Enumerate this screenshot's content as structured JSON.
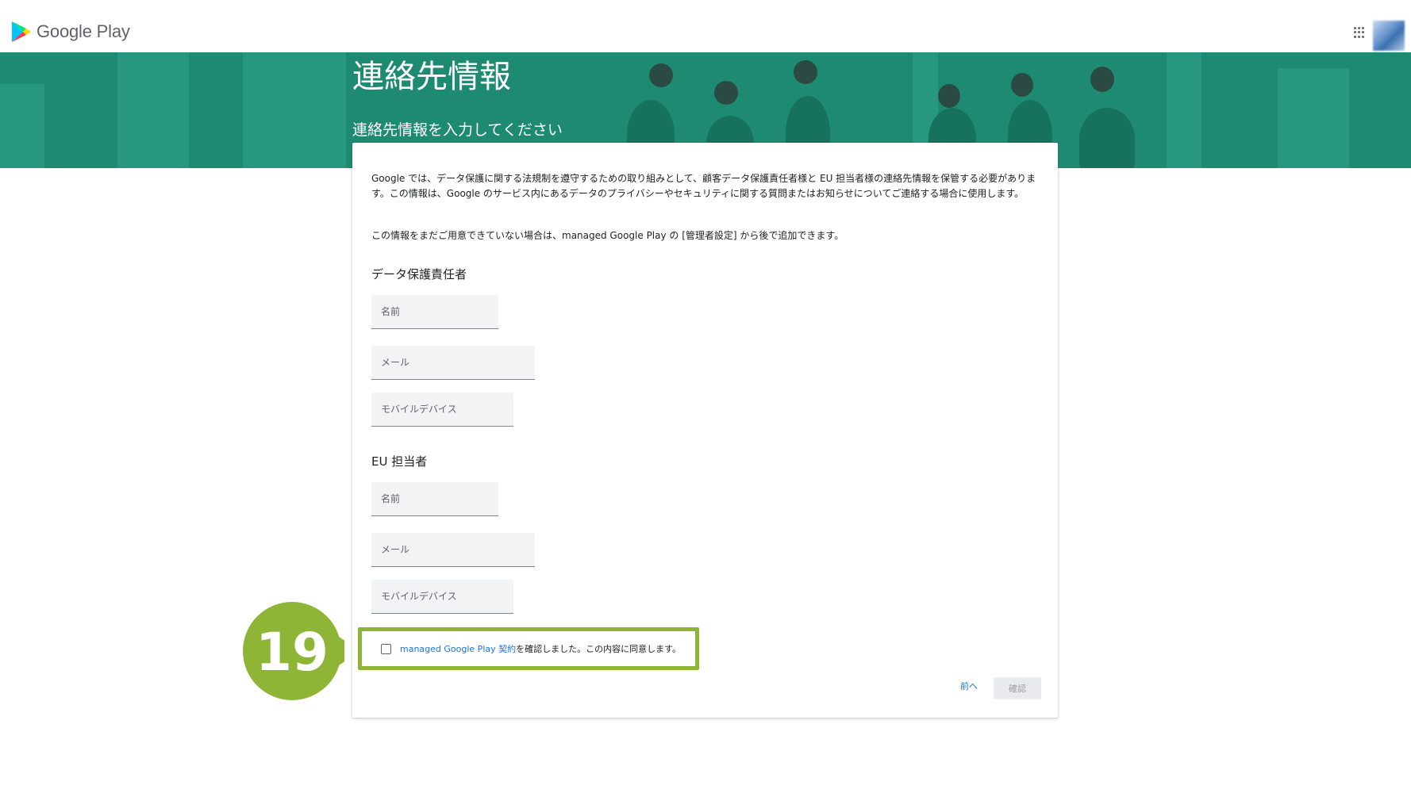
{
  "app": {
    "logo_text": "Google Play"
  },
  "header": {
    "apps_icon": "apps-grid-icon",
    "avatar": "user-avatar"
  },
  "hero": {
    "title": "連絡先情報",
    "subtitle": "連絡先情報を入力してください",
    "background_color": "#1e8a72"
  },
  "card": {
    "intro": "Google では、データ保護に関する法規制を遵守するための取り組みとして、顧客データ保護責任者様と EU 担当者様の連絡先情報を保管する必要があります。この情報は、Google のサービス内にあるデータのプライバシーやセキュリティに関する質問またはお知らせについてご連絡する場合に使用します。",
    "intro2": "この情報をまだご用意できていない場合は、managed Google Play の [管理者設定] から後で追加できます。",
    "dpo": {
      "heading": "データ保護責任者",
      "name_placeholder": "名前",
      "email_placeholder": "メール",
      "mobile_placeholder": "モバイルデバイス"
    },
    "eu": {
      "heading": "EU 担当者",
      "name_placeholder": "名前",
      "email_placeholder": "メール",
      "mobile_placeholder": "モバイルデバイス"
    },
    "agreement": {
      "link_text": "managed Google Play 契約",
      "suffix": "を確認しました。この内容に同意します。",
      "checked": false
    },
    "buttons": {
      "prev": "前へ",
      "confirm": "確認"
    }
  },
  "annotation": {
    "step_number": "19",
    "color": "#8fb537"
  }
}
